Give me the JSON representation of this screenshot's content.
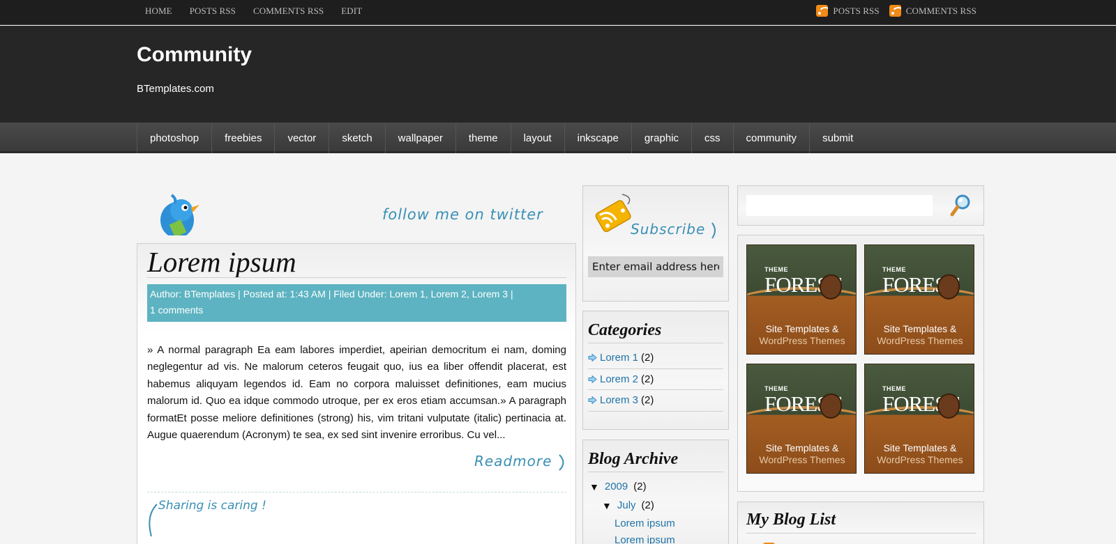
{
  "topbar": {
    "links": [
      "HOME",
      "POSTS RSS",
      "COMMENTS RSS",
      "EDIT"
    ],
    "rss_links": [
      "POSTS RSS",
      "COMMENTS RSS"
    ]
  },
  "header": {
    "title": "Community",
    "description": "BTemplates.com"
  },
  "nav": {
    "items": [
      "photoshop",
      "freebies",
      "vector",
      "sketch",
      "wallpaper",
      "theme",
      "layout",
      "inkscape",
      "graphic",
      "css",
      "community",
      "submit"
    ]
  },
  "twitter": {
    "text": "follow me on twitter"
  },
  "post": {
    "title": "Lorem ipsum",
    "meta_line1": "Author: BTemplates | Posted at: 1:43 AM | Filed Under: Lorem 1, Lorem 2, Lorem 3 |",
    "meta_line2": "1 comments",
    "body": "» A normal paragraph Ea eam labores imperdiet, apeirian democritum ei nam, doming neglegentur ad vis. Ne malorum ceteros feugait quo, ius ea liber offendit placerat, est habemus aliquyam legendos id. Eam no corpora maluisset definitiones, eam mucius malorum id. Quo ea idque commodo utroque, per ex eros etiam accumsan.» A paragraph formatEt posse meliore definitiones (strong) his, vim tritani vulputate (italic) pertinacia at. Augue quaerendum (Acronym) te sea, ex sed sint invenire erroribus. Cu vel...",
    "readmore": "Readmore",
    "sharing": "Sharing is caring !"
  },
  "subscribe": {
    "label": "Subscribe",
    "email_placeholder": "Enter email address here"
  },
  "categories": {
    "title": "Categories",
    "items": [
      {
        "label": "Lorem 1",
        "count": "(2)"
      },
      {
        "label": "Lorem 2",
        "count": "(2)"
      },
      {
        "label": "Lorem 3",
        "count": "(2)"
      }
    ]
  },
  "archive": {
    "title": "Blog Archive",
    "year": "2009",
    "year_count": "(2)",
    "month": "July",
    "month_count": "(2)",
    "posts": [
      "Lorem ipsum",
      "Lorem ipsum"
    ],
    "expanded_symbol": "▼"
  },
  "ads": {
    "small": "THEME",
    "big": "FOREST",
    "line1": "Site Templates &",
    "line2": "WordPress Themes"
  },
  "bloglist": {
    "title": "My Blog List"
  },
  "colors": {
    "accent": "#5db3c1",
    "link": "#1f74a8",
    "handwriting": "#3a8fb5",
    "rss": "#f08a18"
  }
}
